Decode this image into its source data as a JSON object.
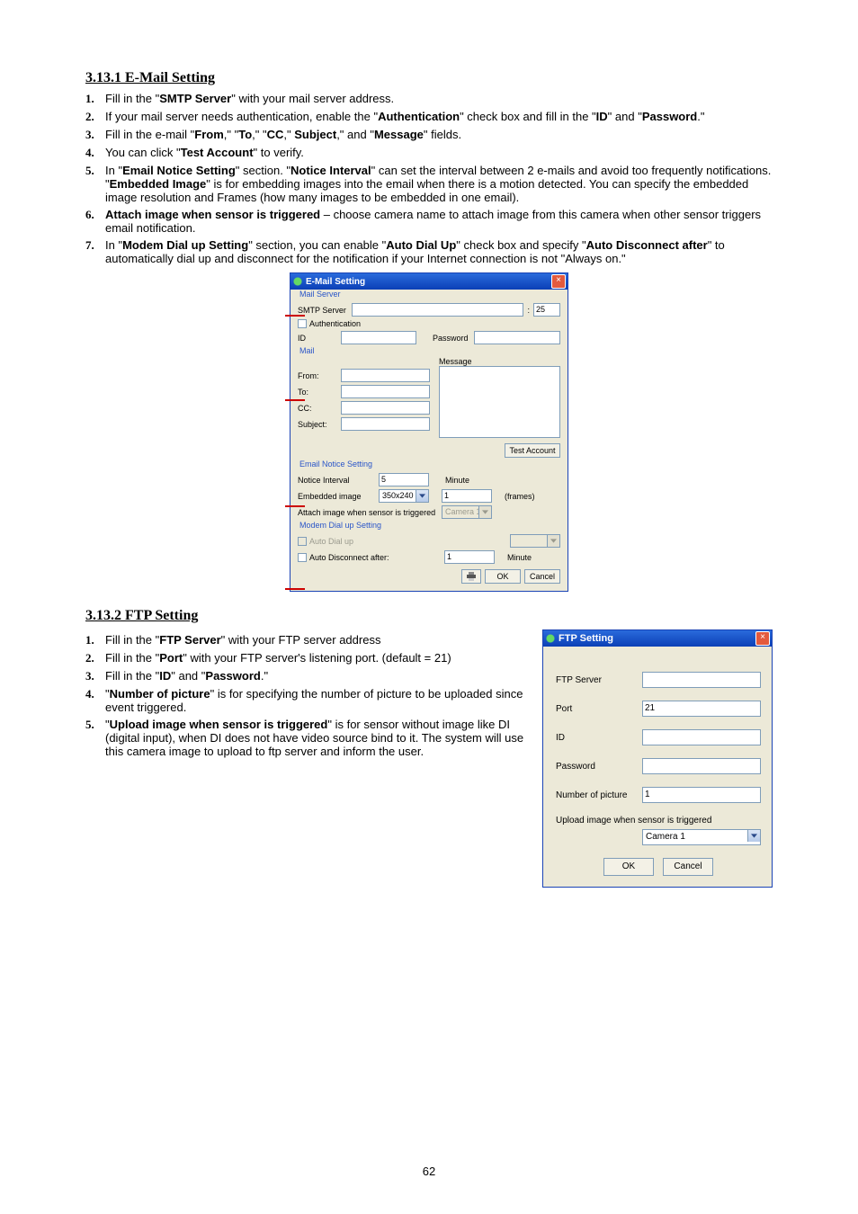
{
  "page_number": "62",
  "email_section": {
    "title": "3.13.1 E-Mail Setting",
    "items": [
      {
        "text": "Fill in the \"SMTP Server\" with your mail server address."
      },
      {
        "text": "If your mail server needs authentication, enable the \"Authentication\" check box and fill in the \"ID\" and \"Password.\""
      },
      {
        "text": "Fill in the e-mail \"From,\" \"To,\" \"CC,\" Subject,\" and \"Message\" fields."
      },
      {
        "text": "You can click \"Test Account\" to verify."
      },
      {
        "text": "In \"Email Notice Setting\" section. \"Notice Interval\" can set the interval between 2 e-mails and avoid too frequently notifications. \"Embedded Image\" is for embedding images into the email when there is a motion detected. You can specify the embedded image resolution and Frames (how many images to be embedded in one email)."
      },
      {
        "text": "Attach image when sensor is triggered – choose camera name to attach image from this camera when other sensor triggers email notification."
      },
      {
        "text": "In \"Modem Dial up Setting\" section, you can enable \"Auto Dial Up\" check box and specify \"Auto Disconnect after\" to automatically dial up and disconnect for the notification if your Internet connection is not \"Always on.\""
      }
    ]
  },
  "email_dialog": {
    "title": "E-Mail Setting",
    "groups": {
      "mail_server": "Mail Server",
      "mail": "Mail",
      "notice": "Email Notice Setting",
      "modem": "Modem Dial up Setting"
    },
    "labels": {
      "smtp": "SMTP Server",
      "sep": ":",
      "port": "25",
      "auth": "Authentication",
      "id": "ID",
      "password": "Password",
      "from": "From:",
      "to": "To:",
      "cc": "CC:",
      "subject": "Subject:",
      "message": "Message",
      "test": "Test Account",
      "interval": "Notice Interval",
      "interval_val": "5",
      "minute": "Minute",
      "embedded": "Embedded image",
      "embedded_val": "350x240",
      "frames_val": "1",
      "frames": "(frames)",
      "attach": "Attach image when sensor is triggered",
      "attach_cam": "Camera 1",
      "autodial": "Auto Dial up",
      "autodisc": "Auto Disconnect after:",
      "autodisc_val": "1",
      "ok": "OK",
      "cancel": "Cancel"
    }
  },
  "ftp_section": {
    "title": "3.13.2 FTP Setting",
    "items": [
      {
        "text": "Fill in the \"FTP Server\" with your FTP server address"
      },
      {
        "text": "Fill in the \"Port\" with your FTP server's listening port. (default = 21)"
      },
      {
        "text": "Fill in the \"ID\" and \"Password.\""
      },
      {
        "text": "\"Number of picture\" is for specifying the number of picture to be uploaded since event triggered."
      },
      {
        "text": "\"Upload image when sensor is triggered\" is for sensor without image like DI (digital input), when DI does not have video source bind to it. The system will use this camera image to upload to ftp server and inform the user."
      }
    ]
  },
  "ftp_dialog": {
    "title": "FTP Setting",
    "labels": {
      "ftp_server": "FTP Server",
      "port": "Port",
      "port_val": "21",
      "id": "ID",
      "password": "Password",
      "numpic": "Number of picture",
      "numpic_val": "1",
      "upload": "Upload image when sensor is triggered",
      "upload_cam": "Camera 1",
      "ok": "OK",
      "cancel": "Cancel"
    }
  }
}
